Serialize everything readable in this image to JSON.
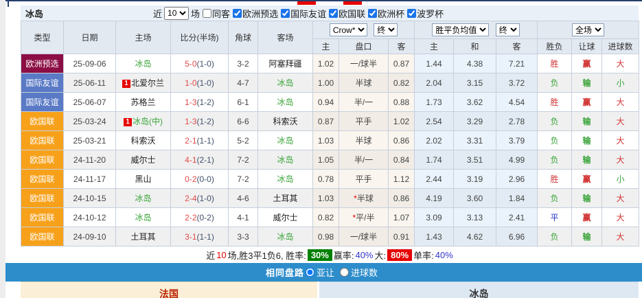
{
  "colors": {
    "type_badges": {
      "欧洲预选": "#8c0e45",
      "国际友谊": "#5b7ac6",
      "欧国联": "#f7a11b"
    },
    "win_rate_badge_bg": "#008000",
    "big_rate_badge_bg": "#e60000",
    "blue_bar_bg": "#2d8dcb",
    "left_panel_bg": "#fbf0d7",
    "right_panel_bg": "#dde8f3",
    "left_panel_title_color": "#bb2200",
    "right_panel_title_color": "#333333"
  },
  "title_bar": {
    "team": "冰岛",
    "near_label": "近",
    "count": "10",
    "games_label": "场",
    "checkboxes": [
      {
        "name": "same-away",
        "label": "同客",
        "checked": false
      },
      {
        "name": "europe-qualifiers",
        "label": "欧洲预选",
        "checked": true
      },
      {
        "name": "international-friendly",
        "label": "国际友谊",
        "checked": true
      },
      {
        "name": "nations-league",
        "label": "欧国联",
        "checked": true
      },
      {
        "name": "european-cup",
        "label": "欧洲杯",
        "checked": true
      },
      {
        "name": "baltic-cup",
        "label": "波罗杯",
        "checked": true
      }
    ]
  },
  "table": {
    "column_headers": [
      "类型",
      "日期",
      "主场",
      "比分(半场)",
      "角球",
      "客场"
    ],
    "sub_headers": [
      "主",
      "盘口",
      "客",
      "主",
      "和",
      "客",
      "胜负",
      "让球",
      "进球数"
    ],
    "selects": {
      "handicap_company": "Crow*",
      "handicap_stage": "终",
      "europe_company": "胜平负均值",
      "europe_stage": "终",
      "scope": "全场"
    },
    "rows": [
      {
        "type": "欧洲预选",
        "date": "25-09-06",
        "home": "冰岛",
        "home_green": true,
        "home_rank": "",
        "score": "5-0",
        "half_score": "(1-0)",
        "corners": "3-2",
        "away": "阿塞拜疆",
        "away_green": false,
        "ah_home": "1.02",
        "ah_star": false,
        "ah_line": "一/球半",
        "ah_away": "0.87",
        "eu_home": "1.44",
        "eu_draw": "4.38",
        "eu_away": "7.21",
        "result_wdl": "胜",
        "result_handicap": "赢",
        "result_goals": "大"
      },
      {
        "type": "国际友谊",
        "date": "25-06-11",
        "home": "北爱尔兰",
        "home_green": false,
        "home_rank": "1",
        "score": "1-0",
        "half_score": "(1-0)",
        "corners": "4-7",
        "away": "冰岛",
        "away_green": true,
        "ah_home": "1.00",
        "ah_star": false,
        "ah_line": "半球",
        "ah_away": "0.82",
        "eu_home": "2.04",
        "eu_draw": "3.15",
        "eu_away": "3.72",
        "result_wdl": "负",
        "result_handicap": "输",
        "result_goals": "小"
      },
      {
        "type": "国际友谊",
        "date": "25-06-07",
        "home": "苏格兰",
        "home_green": false,
        "home_rank": "",
        "score": "1-3",
        "half_score": "(1-2)",
        "corners": "6-1",
        "away": "冰岛",
        "away_green": true,
        "ah_home": "0.94",
        "ah_star": false,
        "ah_line": "半/一",
        "ah_away": "0.88",
        "eu_home": "1.73",
        "eu_draw": "3.62",
        "eu_away": "4.54",
        "result_wdl": "胜",
        "result_handicap": "赢",
        "result_goals": "大"
      },
      {
        "type": "欧国联",
        "date": "25-03-24",
        "home": "冰岛(中)",
        "home_green": true,
        "home_rank": "1",
        "score": "1-3",
        "half_score": "(1-2)",
        "corners": "6-6",
        "away": "科索沃",
        "away_green": false,
        "ah_home": "0.87",
        "ah_star": false,
        "ah_line": "平手",
        "ah_away": "1.02",
        "eu_home": "2.54",
        "eu_draw": "3.29",
        "eu_away": "2.78",
        "result_wdl": "负",
        "result_handicap": "输",
        "result_goals": "大"
      },
      {
        "type": "欧国联",
        "date": "25-03-21",
        "home": "科索沃",
        "home_green": false,
        "home_rank": "",
        "score": "2-1",
        "half_score": "(1-1)",
        "corners": "5-2",
        "away": "冰岛",
        "away_green": true,
        "ah_home": "1.03",
        "ah_star": false,
        "ah_line": "半球",
        "ah_away": "0.86",
        "eu_home": "2.02",
        "eu_draw": "3.31",
        "eu_away": "3.79",
        "result_wdl": "负",
        "result_handicap": "输",
        "result_goals": "大"
      },
      {
        "type": "欧国联",
        "date": "24-11-20",
        "home": "威尔士",
        "home_green": false,
        "home_rank": "",
        "score": "4-1",
        "half_score": "(2-1)",
        "corners": "7-2",
        "away": "冰岛",
        "away_green": true,
        "ah_home": "1.05",
        "ah_star": false,
        "ah_line": "半/一",
        "ah_away": "0.84",
        "eu_home": "1.74",
        "eu_draw": "3.51",
        "eu_away": "4.99",
        "result_wdl": "负",
        "result_handicap": "输",
        "result_goals": "大"
      },
      {
        "type": "欧国联",
        "date": "24-11-17",
        "home": "黑山",
        "home_green": false,
        "home_rank": "",
        "score": "0-2",
        "half_score": "(0-0)",
        "corners": "7-2",
        "away": "冰岛",
        "away_green": true,
        "ah_home": "0.78",
        "ah_star": false,
        "ah_line": "平手",
        "ah_away": "1.12",
        "eu_home": "2.44",
        "eu_draw": "3.19",
        "eu_away": "2.96",
        "result_wdl": "胜",
        "result_handicap": "赢",
        "result_goals": "小"
      },
      {
        "type": "欧国联",
        "date": "24-10-15",
        "home": "冰岛",
        "home_green": true,
        "home_rank": "",
        "score": "2-4",
        "half_score": "(1-0)",
        "corners": "4-6",
        "away": "土耳其",
        "away_green": false,
        "ah_home": "1.03",
        "ah_star": true,
        "ah_line": "半球",
        "ah_away": "0.86",
        "eu_home": "4.19",
        "eu_draw": "3.60",
        "eu_away": "1.84",
        "result_wdl": "负",
        "result_handicap": "输",
        "result_goals": "大"
      },
      {
        "type": "欧国联",
        "date": "24-10-12",
        "home": "冰岛",
        "home_green": true,
        "home_rank": "",
        "score": "2-2",
        "half_score": "(0-2)",
        "corners": "4-1",
        "away": "威尔士",
        "away_green": false,
        "ah_home": "0.82",
        "ah_star": true,
        "ah_line": "平/半",
        "ah_away": "1.07",
        "eu_home": "3.09",
        "eu_draw": "3.13",
        "eu_away": "2.41",
        "result_wdl": "平",
        "result_handicap": "赢",
        "result_goals": "大"
      },
      {
        "type": "欧国联",
        "date": "24-09-10",
        "home": "土耳其",
        "home_green": false,
        "home_rank": "",
        "score": "3-1",
        "half_score": "(1-1)",
        "corners": "3-3",
        "away": "冰岛",
        "away_green": true,
        "ah_home": "0.98",
        "ah_star": false,
        "ah_line": "一/球半",
        "ah_away": "0.91",
        "eu_home": "1.43",
        "eu_draw": "4.62",
        "eu_away": "6.96",
        "result_wdl": "负",
        "result_handicap": "输",
        "result_goals": "大"
      }
    ]
  },
  "summary": {
    "near_label": "近",
    "count": "10",
    "games_text": "场,胜3平1负6, 胜率:",
    "win_rate": "30%",
    "handicap_label": "赢率:",
    "handicap_rate": "40%",
    "big_label": "大:",
    "big_rate": "80%",
    "single_label": "单率:",
    "single_rate": "40%"
  },
  "tab_bar": {
    "title": "相同盘路",
    "options": [
      {
        "name": "asian-handicap",
        "label": "亚让",
        "checked": true
      },
      {
        "name": "goals-count",
        "label": "进球数",
        "checked": false
      }
    ]
  },
  "panels": {
    "left_title": "法国",
    "right_title": "冰岛"
  }
}
